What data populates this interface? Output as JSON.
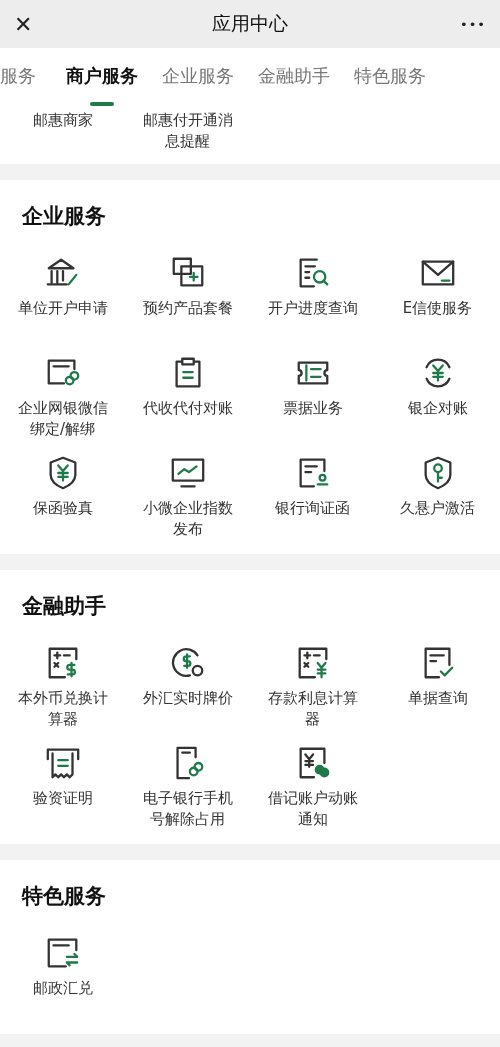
{
  "header": {
    "close": "✕",
    "title": "应用中心",
    "more": "•••"
  },
  "tabs": [
    {
      "label": "服务",
      "selected": false
    },
    {
      "label": "商户服务",
      "selected": true
    },
    {
      "label": "企业服务",
      "selected": false
    },
    {
      "label": "金融助手",
      "selected": false
    },
    {
      "label": "特色服务",
      "selected": false
    }
  ],
  "merchant_items": [
    "邮惠商家",
    "邮惠付开通消息提醒"
  ],
  "sections": [
    {
      "title": "企业服务",
      "items": [
        "单位开户申请",
        "预约产品套餐",
        "开户进度查询",
        "E信使服务",
        "企业网银微信绑定/解绑",
        "代收代付对账",
        "票据业务",
        "银企对账",
        "保函验真",
        "小微企业指数发布",
        "银行询证函",
        "久悬户激活"
      ]
    },
    {
      "title": "金融助手",
      "items": [
        "本外币兑换计算器",
        "外汇实时牌价",
        "存款利息计算器",
        "单据查询",
        "验资证明",
        "电子银行手机号解除占用",
        "借记账户动账通知"
      ]
    },
    {
      "title": "特色服务",
      "items": [
        "邮政汇兑"
      ]
    }
  ]
}
